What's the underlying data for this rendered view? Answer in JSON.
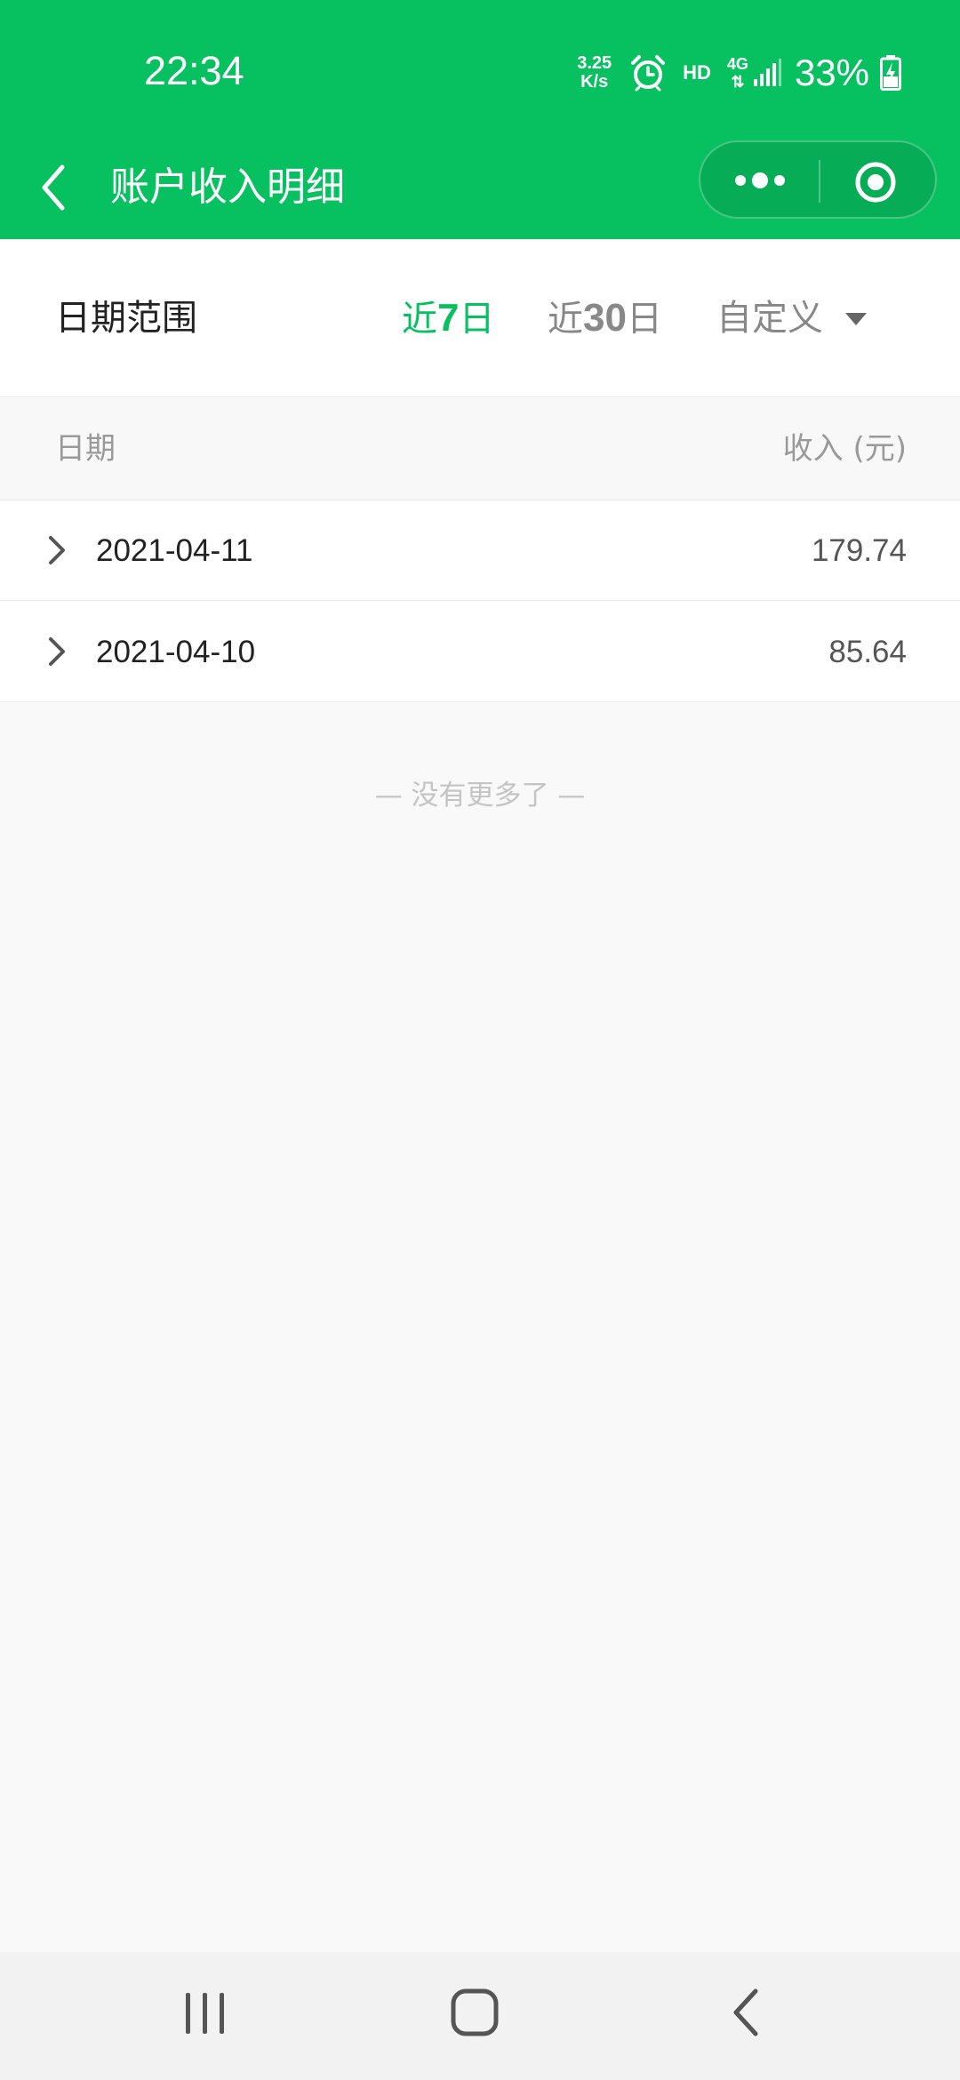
{
  "status_bar": {
    "time": "22:34",
    "net_speed_value": "3.25",
    "net_speed_unit": "K/s",
    "hd_label": "HD",
    "net_type": "4G",
    "battery_percent": "33%",
    "icons": [
      "alarm-icon",
      "signal-icon",
      "battery-charging-icon"
    ]
  },
  "header": {
    "title": "账户收入明细",
    "icons": [
      "back-icon",
      "more-icon",
      "target-icon"
    ],
    "background_color": "#07c160"
  },
  "filter": {
    "label": "日期范围",
    "options": [
      {
        "prefix": "近",
        "number": "7",
        "suffix": "日",
        "selected": true
      },
      {
        "prefix": "近",
        "number": "30",
        "suffix": "日",
        "selected": false
      }
    ],
    "custom_label": "自定义",
    "accent_color": "#07c160"
  },
  "table": {
    "col_date": "日期",
    "col_income": "收入 (元)",
    "rows": [
      {
        "date": "2021-04-11",
        "amount": "179.74"
      },
      {
        "date": "2021-04-10",
        "amount": "85.64"
      }
    ]
  },
  "footer_note": "—   没有更多了   —"
}
